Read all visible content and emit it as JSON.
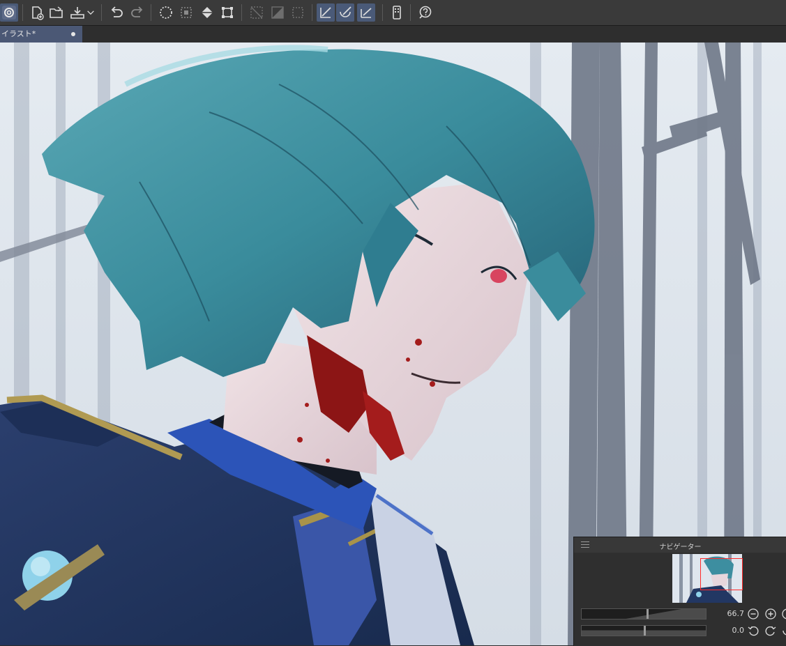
{
  "document_tab": {
    "label": "イラスト*"
  },
  "toolbar": {
    "buttons": [
      {
        "icon": "clip-studio-logo-icon"
      },
      {
        "icon": "new-file-icon"
      },
      {
        "icon": "open-folder-icon"
      },
      {
        "icon": "export-tray-icon"
      },
      {
        "icon": "chevron-down-icon"
      },
      {
        "icon": "undo-icon"
      },
      {
        "icon": "redo-icon"
      },
      {
        "icon": "clear-selection-icon"
      },
      {
        "icon": "selection-crop-icon"
      },
      {
        "icon": "fill-icon"
      },
      {
        "icon": "transform-icon"
      },
      {
        "icon": "hide-selection-icon"
      },
      {
        "icon": "invert-selection-icon"
      },
      {
        "icon": "select-all-icon"
      },
      {
        "icon": "snap-to-ruler-icon"
      },
      {
        "icon": "snap-to-special-ruler-icon"
      },
      {
        "icon": "snap-to-grid-icon"
      },
      {
        "icon": "companion-mode-icon"
      },
      {
        "icon": "help-icon"
      }
    ]
  },
  "navigator": {
    "title": "ナビゲーター",
    "zoom_value": "66.7",
    "zoom_level": 0.52,
    "rotation_value": "0.0",
    "rotation_level": 0.5
  },
  "colors": {
    "toolbar_bg": "#3a3a3a",
    "tab_active": "#4b5875",
    "panel_bg": "#2f2f2f",
    "viewport_frame": "#ff2a2a",
    "hair": "#3d8ea0",
    "background_sky": "#dfe6ee",
    "trees": "#6f7888"
  }
}
